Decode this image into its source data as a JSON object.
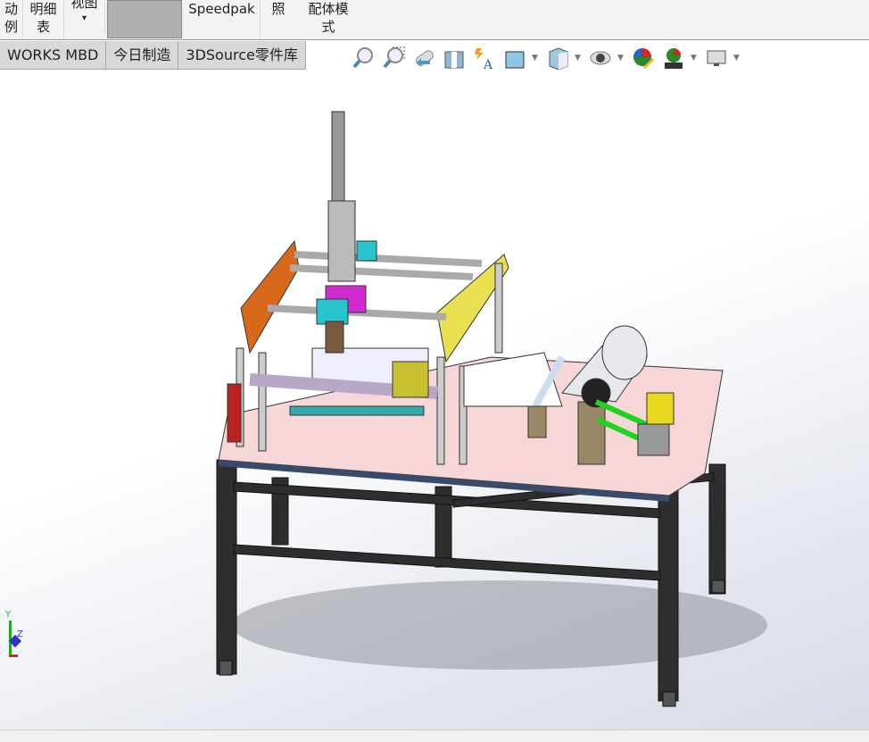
{
  "ribbon": {
    "items": [
      {
        "line1": "动",
        "line2": "例"
      },
      {
        "line1": "明细",
        "line2": "表"
      },
      {
        "line1": "视图",
        "line2": "▾"
      },
      {
        "line1": "Speedpak",
        "line2": ""
      },
      {
        "line1": "照",
        "line2": ""
      },
      {
        "line1": "配体模",
        "line2": "式"
      }
    ]
  },
  "tabs": [
    "WORKS MBD",
    "今日制造",
    "3DSource零件库"
  ],
  "hud": [
    "zoom-to-fit",
    "zoom-to-area",
    "previous-view",
    "section-view",
    "dynamic-annotation-views",
    "view-orientation",
    "display-style",
    "hide-show-items",
    "edit-appearance",
    "apply-scene",
    "view-settings"
  ],
  "triad": {
    "y": "Y",
    "z": "Z"
  },
  "colors": {
    "table_top": "#f6d6d6",
    "frame": "#2a2a2a",
    "cyan": "#29c5cf",
    "yellow": "#e9e051",
    "orange": "#d8691a",
    "magenta": "#d02bd0",
    "green": "#1ed41e"
  }
}
